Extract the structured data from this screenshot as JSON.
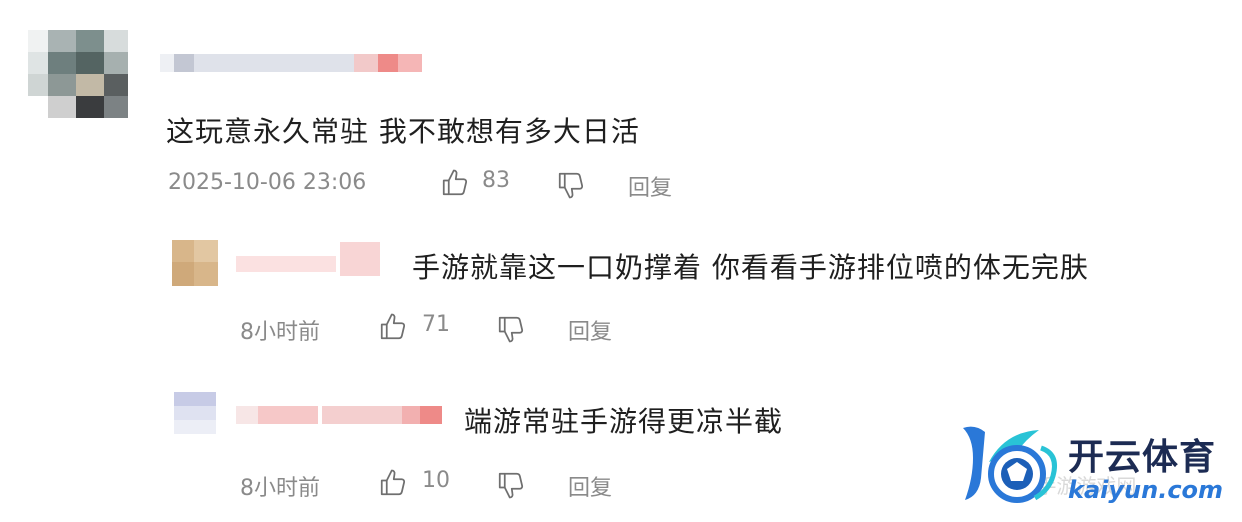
{
  "comments": [
    {
      "text": "这玩意永久常驻 我不敢想有多大日活",
      "timestamp": "2025-10-06 23:06",
      "likes": "83",
      "reply_label": "回复"
    }
  ],
  "replies": [
    {
      "text": "手游就靠这一口奶撑着 你看看手游排位喷的体无完肤",
      "timestamp": "8小时前",
      "likes": "71",
      "reply_label": "回复"
    },
    {
      "text": "端游常驻手游得更凉半截",
      "timestamp": "8小时前",
      "likes": "10",
      "reply_label": "回复"
    }
  ],
  "watermark": {
    "title": "开云体育",
    "url": "kaiyun.com",
    "faint_text": "@ 手游游戏网"
  },
  "colors": {
    "watermark_blue": "#2a78d8",
    "watermark_dark": "#1c2b53",
    "meta_gray": "#8a8a8a"
  },
  "icons": [
    "thumbs-up-icon",
    "thumbs-down-icon",
    "kaiyun-logo-icon"
  ]
}
